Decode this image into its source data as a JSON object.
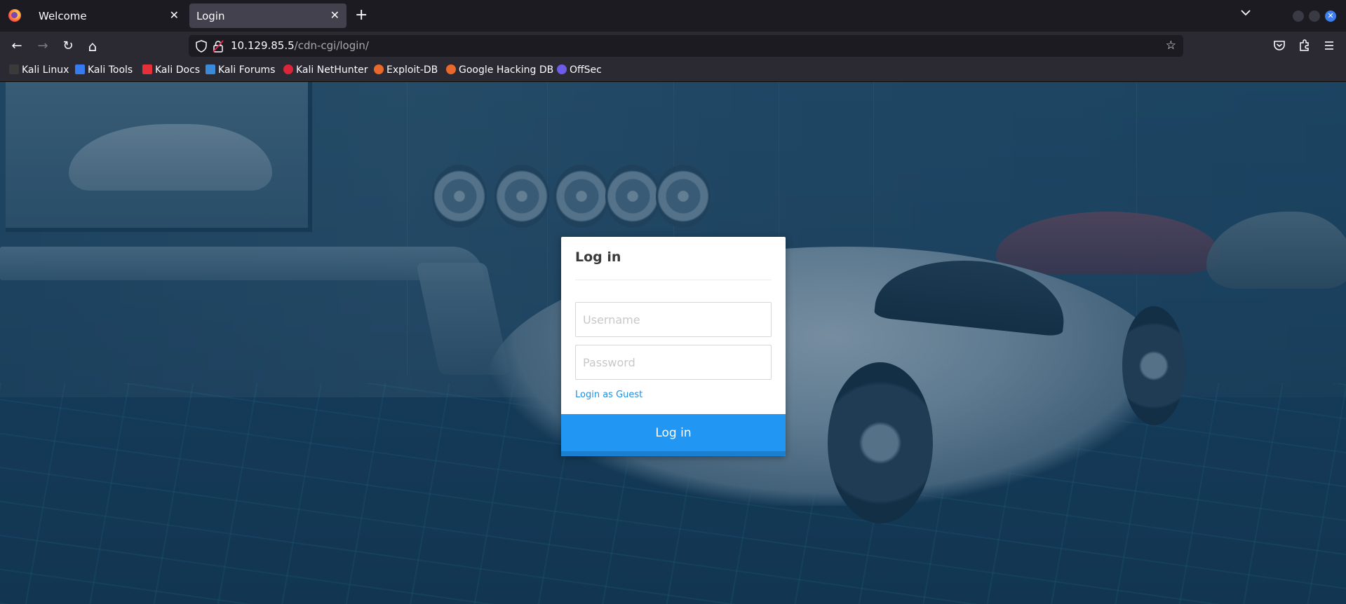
{
  "browser": {
    "tabs": [
      {
        "label": "Welcome",
        "active": false
      },
      {
        "label": "Login",
        "active": true
      }
    ],
    "close_glyph": "✕",
    "new_tab_glyph": "+",
    "window_close_glyph": "✕",
    "url": {
      "host": "10.129.85.5",
      "path": "/cdn-cgi/login/"
    },
    "nav_glyphs": {
      "back": "←",
      "forward": "→",
      "reload": "↻",
      "home": "⌂",
      "bookmark_star": "☆"
    },
    "bookmarks": [
      {
        "label": "Kali Linux",
        "icon": "kali-dragon-icon",
        "color": "#2b2b2b"
      },
      {
        "label": "Kali Tools",
        "icon": "kali-tools-icon",
        "color": "#367bf0"
      },
      {
        "label": "Kali Docs",
        "icon": "kali-docs-icon",
        "color": "#e5303a"
      },
      {
        "label": "Kali Forums",
        "icon": "kali-forums-icon",
        "color": "#3b8ad9"
      },
      {
        "label": "Kali NetHunter",
        "icon": "nethunter-icon",
        "color": "#d9263a"
      },
      {
        "label": "Exploit-DB",
        "icon": "exploit-db-icon",
        "color": "#e8692b"
      },
      {
        "label": "Google Hacking DB",
        "icon": "ghdb-icon",
        "color": "#e8692b"
      },
      {
        "label": "OffSec",
        "icon": "offsec-icon",
        "color": "#6c5ce7"
      }
    ]
  },
  "login": {
    "title": "Log in",
    "username_placeholder": "Username",
    "password_placeholder": "Password",
    "guest_link": "Login as Guest",
    "submit_label": "Log in",
    "accent_color": "#2196f3"
  }
}
